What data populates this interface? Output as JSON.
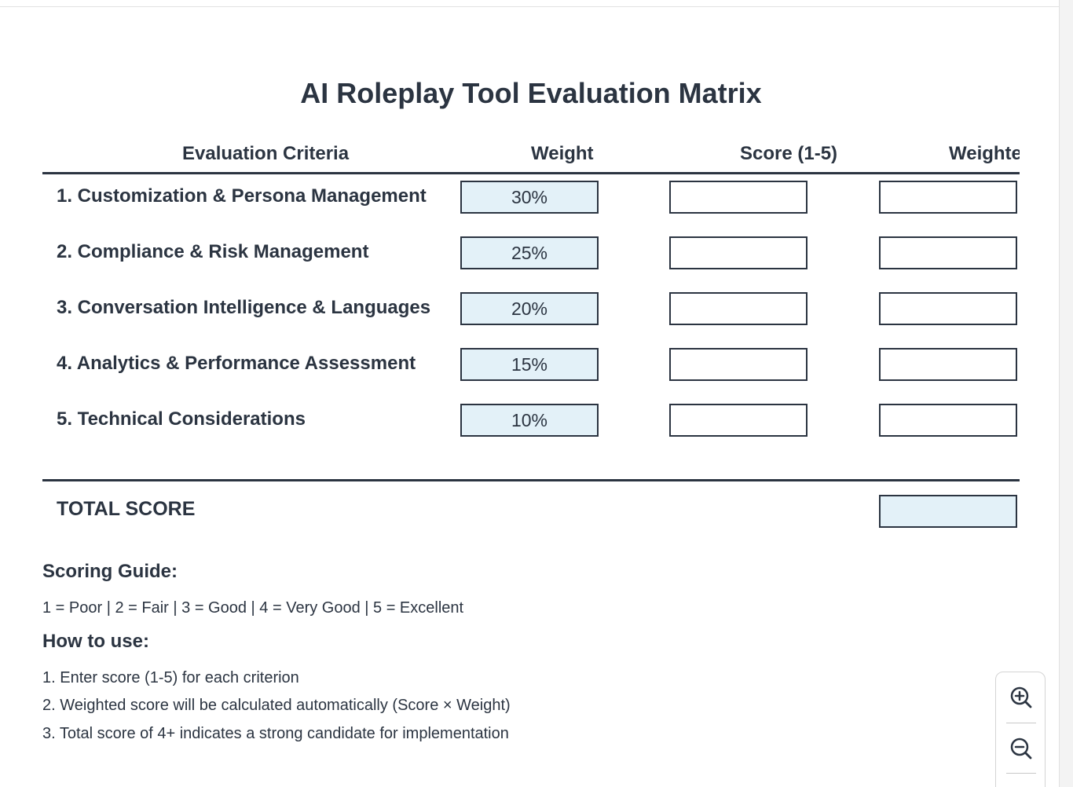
{
  "title": "AI Roleplay Tool Evaluation Matrix",
  "headers": {
    "criteria": "Evaluation Criteria",
    "weight": "Weight",
    "score": "Score (1-5)",
    "weighted": "Weighted Score"
  },
  "criteria": [
    {
      "label": "1. Customization & Persona Management",
      "weight": "30%",
      "score": "",
      "weighted": ""
    },
    {
      "label": "2. Compliance & Risk Management",
      "weight": "25%",
      "score": "",
      "weighted": ""
    },
    {
      "label": "3. Conversation Intelligence & Languages",
      "weight": "20%",
      "score": "",
      "weighted": ""
    },
    {
      "label": "4. Analytics & Performance Assessment",
      "weight": "15%",
      "score": "",
      "weighted": ""
    },
    {
      "label": "5. Technical Considerations",
      "weight": "10%",
      "score": "",
      "weighted": ""
    }
  ],
  "total": {
    "label": "TOTAL SCORE",
    "value": ""
  },
  "guide": {
    "scoring_title": "Scoring Guide:",
    "scoring_text": "1 = Poor | 2 = Fair | 3 = Good | 4 = Very Good | 5 = Excellent",
    "howto_title": "How to use:",
    "steps": [
      "1. Enter score (1-5) for each criterion",
      "2. Weighted score will be calculated automatically (Score × Weight)",
      "3. Total score of 4+ indicates a strong candidate for implementation"
    ]
  },
  "zoom": {
    "in_icon": "zoom-in-icon",
    "out_icon": "zoom-out-icon"
  },
  "colors": {
    "text": "#2b3441",
    "weight_fill": "#e3f1f8"
  }
}
